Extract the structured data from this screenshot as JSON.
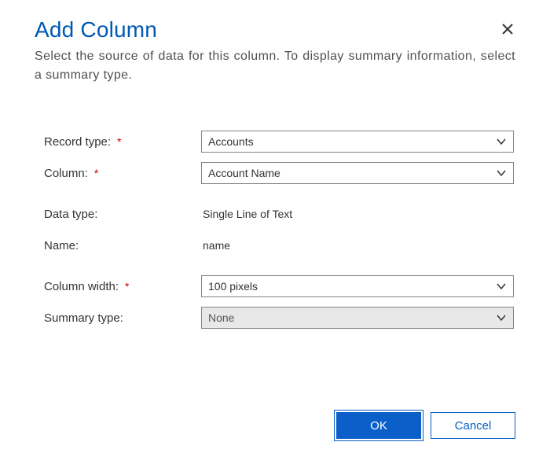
{
  "title": "Add Column",
  "subtitle": "Select the source of data for this column. To display summary information, select a summary type.",
  "labels": {
    "record_type": "Record type:",
    "column": "Column:",
    "data_type": "Data type:",
    "name": "Name:",
    "column_width": "Column width:",
    "summary_type": "Summary type:"
  },
  "values": {
    "record_type": "Accounts",
    "column": "Account Name",
    "data_type": "Single Line of Text",
    "name": "name",
    "column_width": "100 pixels",
    "summary_type": "None"
  },
  "buttons": {
    "ok": "OK",
    "cancel": "Cancel"
  }
}
